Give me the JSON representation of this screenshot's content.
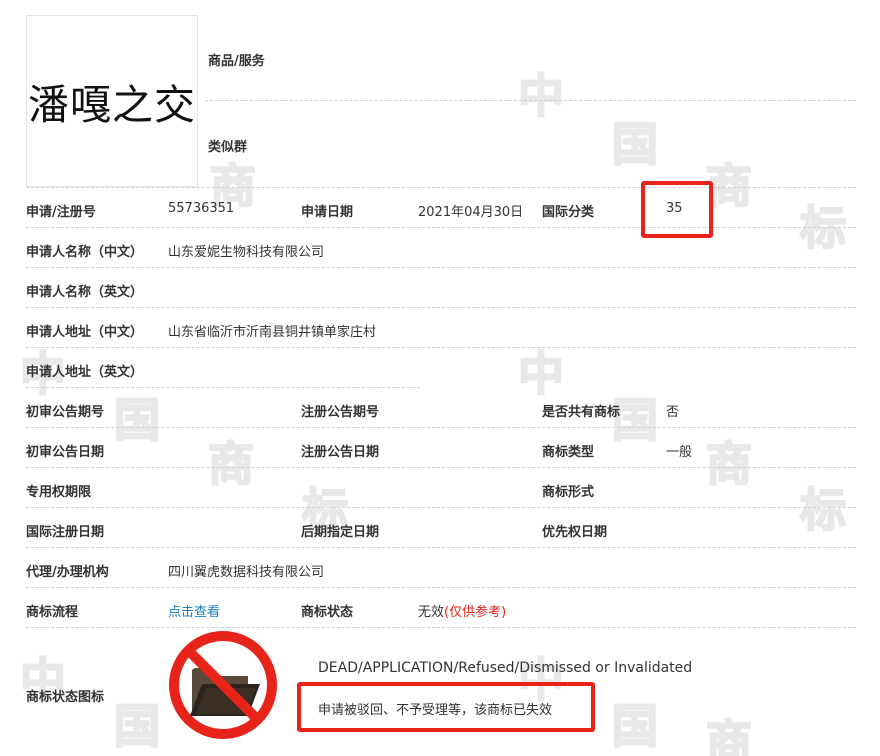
{
  "logo_text": "潘嘎之交",
  "top": {
    "goods_label": "商品/服务",
    "similar_label": "类似群"
  },
  "rows": {
    "reg_no_label": "申请/注册号",
    "reg_no_value": "55736351",
    "app_date_label": "申请日期",
    "app_date_value": "2021年04月30日",
    "intl_class_label": "国际分类",
    "intl_class_value": "35",
    "applicant_cn_label": "申请人名称（中文）",
    "applicant_cn_value": "山东爱妮生物科技有限公司",
    "applicant_en_label": "申请人名称（英文）",
    "address_cn_label": "申请人地址（中文）",
    "address_cn_value": "山东省临沂市沂南县铜井镇单家庄村",
    "address_en_label": "申请人地址（英文）",
    "prelim_issue_label": "初审公告期号",
    "reg_issue_label": "注册公告期号",
    "shared_label": "是否共有商标",
    "shared_value": "否",
    "prelim_date_label": "初审公告日期",
    "reg_date_label": "注册公告日期",
    "tm_type_label": "商标类型",
    "tm_type_value": "一般",
    "exclusive_label": "专用权期限",
    "tm_form_label": "商标形式",
    "intl_reg_date_label": "国际注册日期",
    "later_date_label": "后期指定日期",
    "priority_date_label": "优先权日期",
    "agent_label": "代理/办理机构",
    "agent_value": "四川翼虎数据科技有限公司",
    "process_label": "商标流程",
    "process_link": "点击查看",
    "status_label": "商标状态",
    "status_value": "无效",
    "status_note": "(仅供参考)",
    "status_icon_label": "商标状态图标"
  },
  "status": {
    "en": "DEAD/APPLICATION/Refused/Dismissed or Invalidated",
    "cn": "申请被驳回、不予受理等，该商标已失效"
  },
  "watermark": [
    "中",
    "国",
    "商",
    "标"
  ],
  "colors": {
    "highlight_red": "#e8231a",
    "link_blue": "#1a7fbd",
    "note_red": "#e2231a"
  }
}
